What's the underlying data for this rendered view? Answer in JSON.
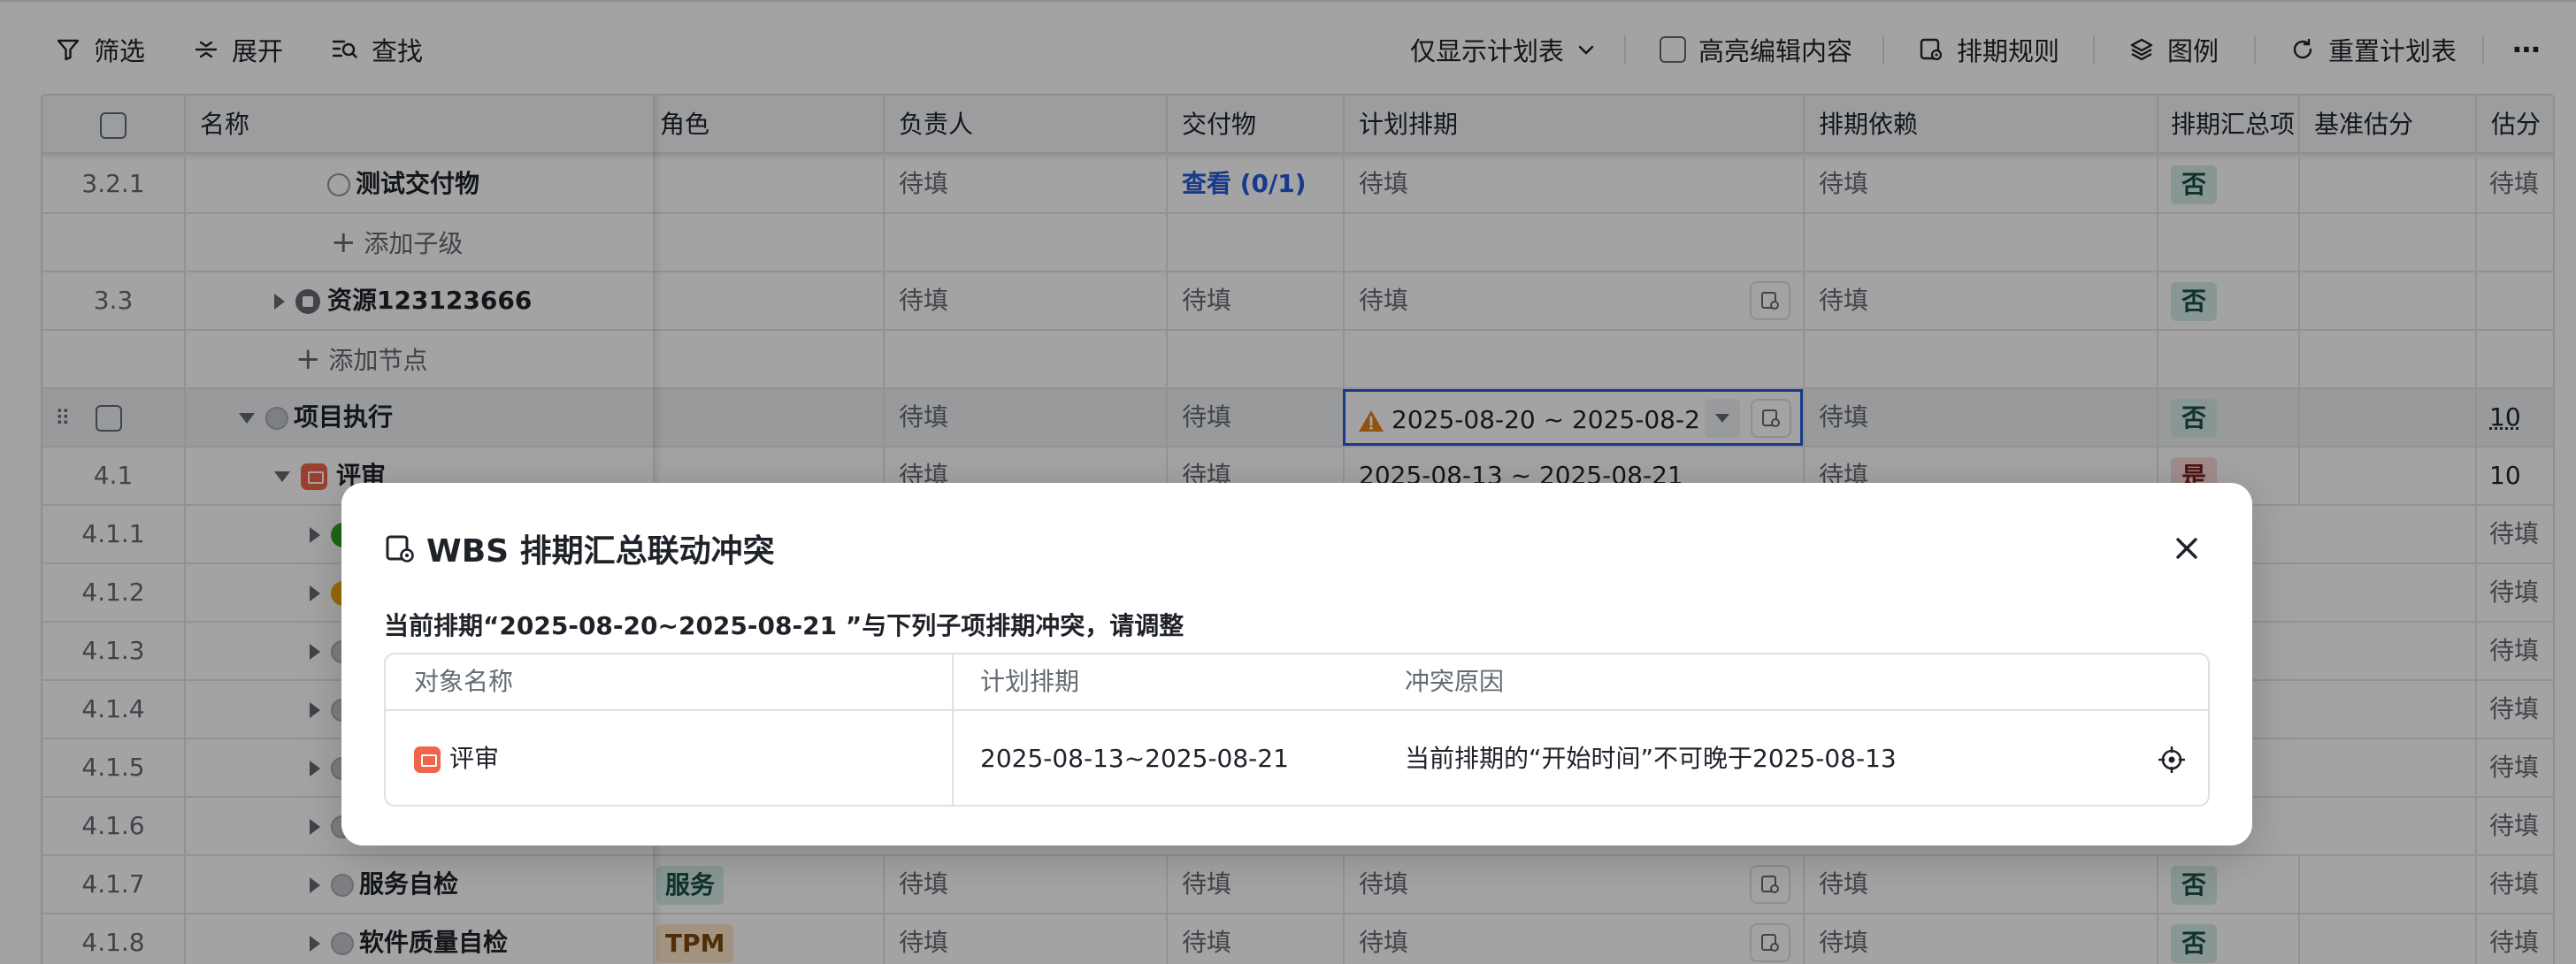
{
  "toolbar": {
    "filter": "筛选",
    "expand": "展开",
    "find": "查找",
    "view_select": "仅显示计划表",
    "highlight": "高亮编辑内容",
    "schedule_rules": "排期规则",
    "legend": "图例",
    "reset": "重置计划表",
    "more": "⋯"
  },
  "columns": {
    "name": "名称",
    "role": "角色",
    "owner": "负责人",
    "deliverable": "交付物",
    "plan": "计划排期",
    "dependency": "排期依赖",
    "summary": "排期汇总项",
    "baseline": "基准估分",
    "estimate": "估分"
  },
  "rows": [
    {
      "num": "3.2.1",
      "name": "测试交付物",
      "owner": "待填",
      "deliverable": "查看 (0/1)",
      "plan": "待填",
      "dependency": "待填",
      "summary": "否",
      "estimate": "待填"
    },
    {
      "add": "添加子级"
    },
    {
      "num": "3.3",
      "name": "资源123123666",
      "owner": "待填",
      "deliverable": "待填",
      "plan": "待填",
      "dependency": "待填",
      "summary": "否"
    },
    {
      "add": "添加节点"
    },
    {
      "name": "项目执行",
      "owner": "待填",
      "deliverable": "待填",
      "plan": "2025-08-20 ~ 2025-08-2",
      "dependency": "待填",
      "summary": "否",
      "estimate": "10"
    },
    {
      "num": "4.1",
      "name": "评审",
      "owner": "待填",
      "deliverable": "待填",
      "plan": "2025-08-13 ~ 2025-08-21",
      "dependency": "待填",
      "summary": "是",
      "estimate": "10"
    },
    {
      "num": "4.1.1",
      "estimate": "待填"
    },
    {
      "num": "4.1.2",
      "estimate": "待填"
    },
    {
      "num": "4.1.3",
      "estimate": "待填"
    },
    {
      "num": "4.1.4",
      "estimate": "待填"
    },
    {
      "num": "4.1.5",
      "estimate": "待填"
    },
    {
      "num": "4.1.6",
      "estimate": "待填"
    },
    {
      "num": "4.1.7",
      "name": "服务自检",
      "role": "服务",
      "owner": "待填",
      "deliverable": "待填",
      "plan": "待填",
      "dependency": "待填",
      "summary": "否",
      "estimate": "待填"
    },
    {
      "num": "4.1.8",
      "name": "软件质量自检",
      "role": "TPM",
      "owner": "待填",
      "deliverable": "待填",
      "plan": "待填",
      "dependency": "待填",
      "summary": "否",
      "estimate": "待填"
    }
  ],
  "dialog": {
    "title": "WBS 排期汇总联动冲突",
    "message": "当前排期“2025-08-20~2025-08-21 ”与下列子项排期冲突，请调整",
    "col_object": "对象名称",
    "col_plan": "计划排期",
    "col_reason": "冲突原因",
    "row": {
      "object": "评审",
      "plan": "2025-08-13~2025-08-21",
      "reason": "当前排期的“开始时间”不可晚于2025-08-13"
    }
  },
  "colors": {
    "accent": "#245bdb",
    "warning": "#e8801a",
    "tag_no_bg": "#d7ece8",
    "tag_yes_bg": "#fbd9d9",
    "review_icon": "#f0654a"
  }
}
